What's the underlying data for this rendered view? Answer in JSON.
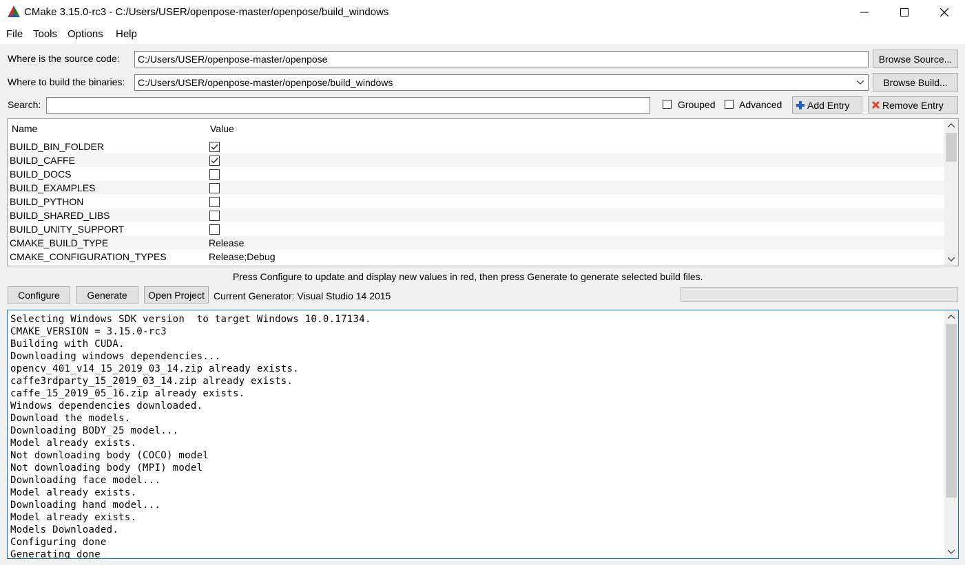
{
  "window": {
    "title": "CMake 3.15.0-rc3 - C:/Users/USER/openpose-master/openpose/build_windows"
  },
  "menu": [
    "File",
    "Tools",
    "Options",
    "Help"
  ],
  "source": {
    "label": "Where is the source code:",
    "value": "C:/Users/USER/openpose-master/openpose",
    "browse_label": "Browse Source..."
  },
  "build": {
    "label": "Where to build the binaries:",
    "value": "C:/Users/USER/openpose-master/openpose/build_windows",
    "browse_label": "Browse Build..."
  },
  "search": {
    "label": "Search:",
    "value": "",
    "grouped_label": "Grouped",
    "grouped_checked": false,
    "advanced_label": "Advanced",
    "advanced_checked": false,
    "add_entry_label": "Add Entry",
    "remove_entry_label": "Remove Entry"
  },
  "table": {
    "headers": [
      "Name",
      "Value"
    ],
    "rows": [
      {
        "name": "BUILD_BIN_FOLDER",
        "type": "bool",
        "checked": true,
        "value": ""
      },
      {
        "name": "BUILD_CAFFE",
        "type": "bool",
        "checked": true,
        "value": ""
      },
      {
        "name": "BUILD_DOCS",
        "type": "bool",
        "checked": false,
        "value": ""
      },
      {
        "name": "BUILD_EXAMPLES",
        "type": "bool",
        "checked": false,
        "value": ""
      },
      {
        "name": "BUILD_PYTHON",
        "type": "bool",
        "checked": false,
        "value": ""
      },
      {
        "name": "BUILD_SHARED_LIBS",
        "type": "bool",
        "checked": false,
        "value": ""
      },
      {
        "name": "BUILD_UNITY_SUPPORT",
        "type": "bool",
        "checked": false,
        "value": ""
      },
      {
        "name": "CMAKE_BUILD_TYPE",
        "type": "string",
        "value": "Release"
      },
      {
        "name": "CMAKE_CONFIGURATION_TYPES",
        "type": "string",
        "value": "Release;Debug"
      }
    ]
  },
  "hint": "Press Configure to update and display new values in red, then press Generate to generate selected build files.",
  "actions": {
    "configure_label": "Configure",
    "generate_label": "Generate",
    "open_project_label": "Open Project",
    "current_generator": "Current Generator: Visual Studio 14 2015"
  },
  "progress": 0,
  "output": [
    "Selecting Windows SDK version  to target Windows 10.0.17134.",
    "CMAKE_VERSION = 3.15.0-rc3",
    "Building with CUDA.",
    "Downloading windows dependencies...",
    "opencv_401_v14_15_2019_03_14.zip already exists.",
    "caffe3rdparty_15_2019_03_14.zip already exists.",
    "caffe_15_2019_05_16.zip already exists.",
    "Windows dependencies downloaded.",
    "Download the models.",
    "Downloading BODY_25 model...",
    "Model already exists.",
    "Not downloading body (COCO) model",
    "Not downloading body (MPI) model",
    "Downloading face model...",
    "Model already exists.",
    "Downloading hand model...",
    "Model already exists.",
    "Models Downloaded.",
    "Configuring done",
    "Generating done"
  ],
  "colors": {
    "accent_blue": "#0078d7",
    "remove_red": "#e0422a",
    "add_blue": "#1f5fbf"
  },
  "icons": [
    "cmake-logo-icon",
    "minimize-icon",
    "maximize-icon",
    "close-icon",
    "dropdown-arrow-icon",
    "plus-icon",
    "x-icon",
    "checkmark-icon",
    "scroll-up-icon",
    "scroll-down-icon"
  ]
}
